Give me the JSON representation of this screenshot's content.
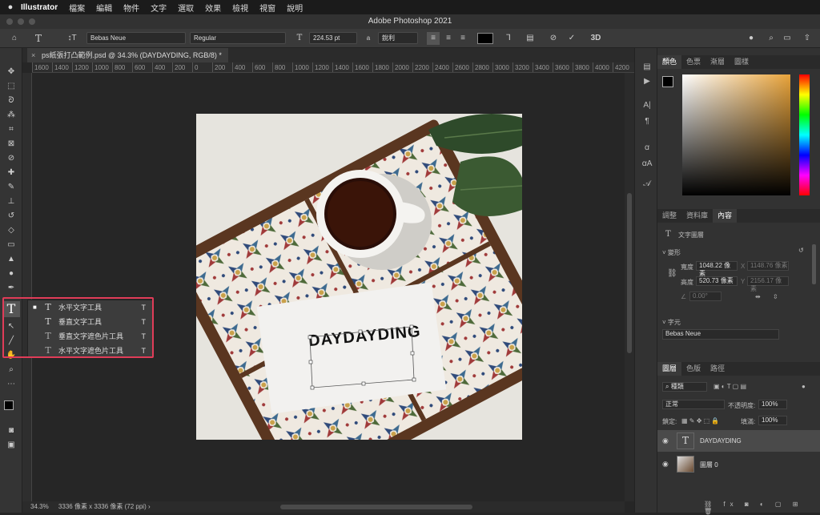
{
  "menubar": {
    "app": "Illustrator",
    "items": [
      "檔案",
      "編輯",
      "物件",
      "文字",
      "選取",
      "效果",
      "檢視",
      "視窗",
      "說明"
    ]
  },
  "titlebar": {
    "title": "Adobe Photoshop 2021"
  },
  "options": {
    "font_family": "Bebas Neue",
    "font_style": "Regular",
    "font_size": "224.53 pt",
    "aa_icon": "a",
    "antialias": "銳利",
    "cancel_icon": "⊘",
    "commit_icon": "✓",
    "threed": "3D"
  },
  "document": {
    "tab": "ps紙張打凸範例.psd @ 34.3% (DAYDAYDING, RGB/8) *",
    "canvas_text": "DAYDAYDING"
  },
  "ruler_h": [
    "1600",
    "1400",
    "1200",
    "1000",
    "800",
    "600",
    "400",
    "200",
    "0",
    "200",
    "400",
    "600",
    "800",
    "1000",
    "1200",
    "1400",
    "1600",
    "1800",
    "2000",
    "2200",
    "2400",
    "2600",
    "2800",
    "3000",
    "3200",
    "3400",
    "3600",
    "3800",
    "4000",
    "4200"
  ],
  "status": {
    "zoom": "34.3%",
    "info": "3336 像素 x 3336 像素 (72 ppi)"
  },
  "flyout": {
    "items": [
      {
        "label": "水平文字工具",
        "shortcut": "T",
        "icon": "T"
      },
      {
        "label": "垂直文字工具",
        "shortcut": "T",
        "icon": "T"
      },
      {
        "label": "垂直文字遮色片工具",
        "shortcut": "T",
        "icon": "T"
      },
      {
        "label": "水平文字遮色片工具",
        "shortcut": "T",
        "icon": "T"
      }
    ]
  },
  "color_panel": {
    "tabs": [
      "顏色",
      "色票",
      "漸層",
      "圖樣"
    ]
  },
  "properties_panel": {
    "tabs": [
      "調整",
      "資料庫",
      "內容"
    ],
    "layer_type": "文字圖層",
    "transform_title": "變形",
    "width_label": "寬度",
    "width_value": "1048.22 像素",
    "height_label": "高度",
    "height_value": "520.73 像素",
    "x_label": "X",
    "x_value": "1148.76 像素",
    "y_label": "Y",
    "y_value": "2156.17 像素",
    "angle": "0.00°",
    "char_title": "字元",
    "char_font": "Bebas Neue"
  },
  "layers_panel": {
    "tabs": [
      "圖層",
      "色版",
      "路徑"
    ],
    "filter": "種類",
    "blend_mode": "正常",
    "opacity_label": "不透明度:",
    "opacity": "100%",
    "lock_label": "鎖定:",
    "fill_label": "填滿:",
    "fill": "100%",
    "layers": [
      {
        "name": "DAYDAYDING",
        "type": "text"
      },
      {
        "name": "圖層 0",
        "type": "image"
      }
    ]
  },
  "colors": {
    "accent": "#e03c58",
    "panel_bg": "#323232",
    "canvas_bg": "#262626"
  }
}
